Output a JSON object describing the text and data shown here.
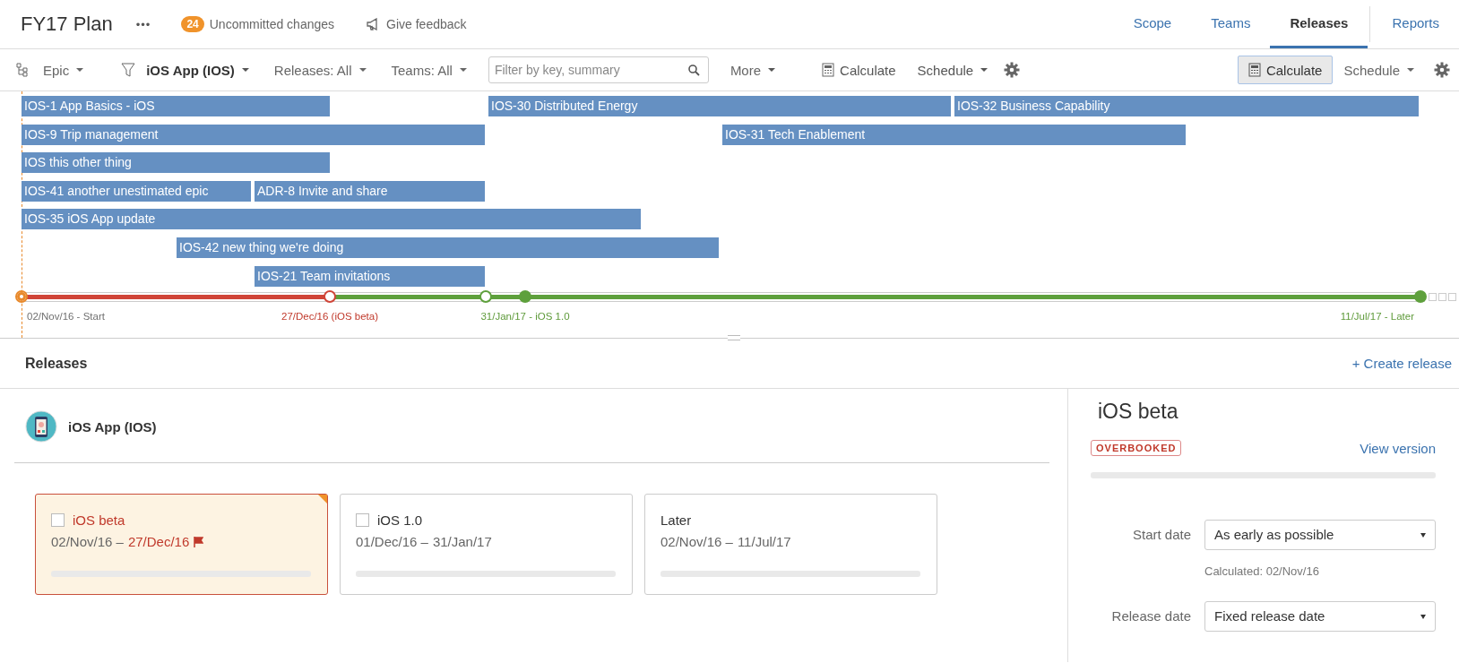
{
  "header": {
    "title": "FY17 Plan",
    "more": "•••",
    "changes_count": "24",
    "changes_label": "Uncommitted changes",
    "feedback": "Give feedback"
  },
  "tabs": [
    {
      "label": "Scope",
      "selected": false
    },
    {
      "label": "Teams",
      "selected": false
    },
    {
      "label": "Releases",
      "selected": true
    },
    {
      "label": "Reports",
      "selected": false
    }
  ],
  "toolbar": {
    "hierarchy": "Epic",
    "project": "iOS App (IOS)",
    "releases": "Releases: All",
    "teams": "Teams: All",
    "search": {
      "placeholder": "Filter by key, summary"
    },
    "more": "More",
    "calculate": "Calculate",
    "schedule": "Schedule",
    "right_calculate": {
      "label": "Calculate",
      "pressed": true
    },
    "right_schedule": "Schedule"
  },
  "bars": [
    {
      "label": "IOS-1 App Basics - iOS"
    },
    {
      "label": "IOS-30 Distributed Energy"
    },
    {
      "label": "IOS-32 Business Capability"
    },
    {
      "label": "IOS-9 Trip management"
    },
    {
      "label": "IOS-31 Tech Enablement"
    },
    {
      "label": "IOS this other thing"
    },
    {
      "label": "IOS-41 another unestimated epic"
    },
    {
      "label": "ADR-8 Invite and share"
    },
    {
      "label": "IOS-35 iOS App update"
    },
    {
      "label": "IOS-42 new thing we're doing"
    },
    {
      "label": "IOS-21 Team invitations"
    }
  ],
  "milestones": [
    {
      "kind": "start",
      "color": "#e8892b"
    },
    {
      "kind": "hollow",
      "color": "#d04437"
    },
    {
      "kind": "hollow",
      "color": "#5ea03c"
    },
    {
      "kind": "filled",
      "color": "#5ea03c"
    },
    {
      "kind": "filled",
      "color": "#5ea03c"
    }
  ],
  "milestone_labels": [
    {
      "text": "02/Nov/16 - Start",
      "color": "#707070"
    },
    {
      "text": "27/Dec/16 (iOS beta)",
      "color": "#c0392b"
    },
    {
      "text": "31/Jan/17 - iOS 1.0",
      "color": "#5e9a3a"
    },
    {
      "text": "11/Jul/17 - Later",
      "color": "#5e9a3a"
    }
  ],
  "releases": {
    "title": "Releases",
    "create": "+ Create release",
    "project": "iOS App (IOS)",
    "cards": [
      {
        "kind": "checkable",
        "name": "iOS beta",
        "checked": false,
        "selected": true,
        "start": "02/Nov/16 –",
        "end": "27/Dec/16",
        "flagged": true,
        "level": 0
      },
      {
        "kind": "checkable",
        "name": "iOS 1.0",
        "checked": false,
        "selected": false,
        "start": "01/Dec/16 –",
        "end": "31/Jan/17",
        "flagged": false,
        "level": 0
      },
      {
        "kind": "plain",
        "name": "Later",
        "selected": false,
        "start": "02/Nov/16 –",
        "end": "11/Jul/17",
        "flagged": false,
        "level": 0
      }
    ]
  },
  "detail": {
    "title": "iOS beta",
    "status": "OVERBOOKED",
    "view": "View version",
    "level": 0,
    "fields": [
      {
        "label": "Start date",
        "value": "As early as possible",
        "note": "Calculated: 02/Nov/16"
      },
      {
        "label": "Release date",
        "value": "Fixed release date"
      }
    ]
  }
}
